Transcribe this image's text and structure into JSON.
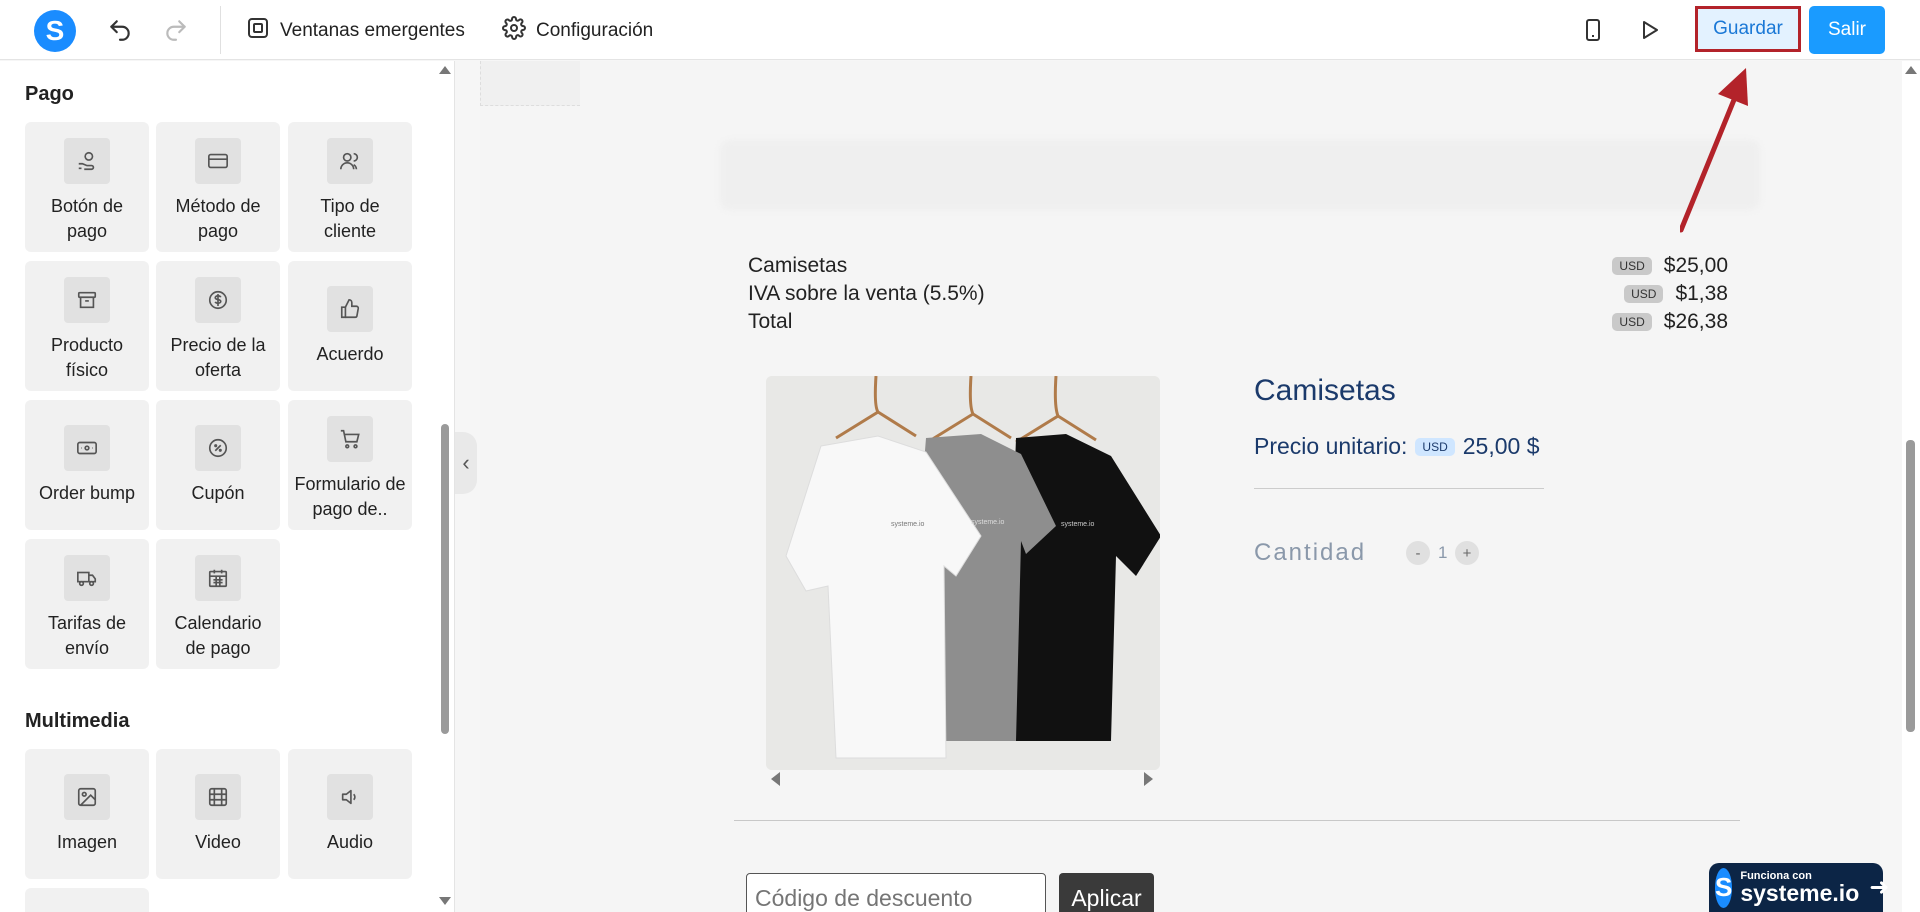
{
  "topbar": {
    "logo_letter": "S",
    "popups_label": "Ventanas emergentes",
    "settings_label": "Configuración",
    "save_label": "Guardar",
    "exit_label": "Salir"
  },
  "sidebar": {
    "payment_title": "Pago",
    "payment_items": [
      {
        "label": "Botón de pago",
        "icon": "hand-coin-icon"
      },
      {
        "label": "Método de pago",
        "icon": "credit-card-icon"
      },
      {
        "label": "Tipo de cliente",
        "icon": "users-icon"
      },
      {
        "label": "Producto físico",
        "icon": "archive-box-icon"
      },
      {
        "label": "Precio de la oferta",
        "icon": "dollar-circle-icon"
      },
      {
        "label": "Acuerdo",
        "icon": "thumbs-up-icon"
      },
      {
        "label": "Order bump",
        "icon": "ticket-icon"
      },
      {
        "label": "Cupón",
        "icon": "discount-icon"
      },
      {
        "label": "Formulario de pago de..",
        "icon": "cart-icon"
      },
      {
        "label": "Tarifas de envío",
        "icon": "truck-icon"
      },
      {
        "label": "Calendario de pago",
        "icon": "calendar-icon"
      }
    ],
    "media_title": "Multimedia",
    "media_items": [
      {
        "label": "Imagen",
        "icon": "image-icon"
      },
      {
        "label": "Video",
        "icon": "film-icon"
      },
      {
        "label": "Audio",
        "icon": "speaker-icon"
      }
    ]
  },
  "summary": {
    "rows": [
      {
        "label": "Camisetas",
        "currency": "USD",
        "amount": "$25,00"
      },
      {
        "label": "IVA sobre la venta (5.5%)",
        "currency": "USD",
        "amount": "$1,38"
      },
      {
        "label": "Total",
        "currency": "USD",
        "amount": "$26,38"
      }
    ]
  },
  "product": {
    "title": "Camisetas",
    "unit_price_label": "Precio unitario:",
    "currency": "USD",
    "unit_price_value": "25,00 $",
    "quantity_label": "Cantidad",
    "quantity_value": "1",
    "minus": "-",
    "plus": "+",
    "shirt_text": "systeme.io"
  },
  "discount": {
    "placeholder": "Código de descuento",
    "apply_label": "Aplicar"
  },
  "powered_by": {
    "small": "Funciona con",
    "big": "systeme.io",
    "logo_letter": "S"
  },
  "colors": {
    "accent": "#1a9bff",
    "annotation": "#b3232a",
    "product_text": "#1b3a6b"
  }
}
